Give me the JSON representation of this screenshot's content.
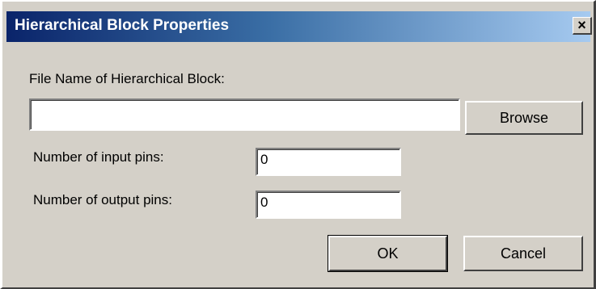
{
  "dialog": {
    "title": "Hierarchical Block Properties",
    "close_label": "×"
  },
  "file_name": {
    "label": "File Name of Hierarchical Block:",
    "value": "",
    "browse_label": "Browse"
  },
  "input_pins": {
    "label": "Number of input pins:",
    "value": "0"
  },
  "output_pins": {
    "label": "Number of output pins:",
    "value": "0"
  },
  "buttons": {
    "ok_label": "OK",
    "cancel_label": "Cancel"
  },
  "colors": {
    "dialog_background": "#d4d0c8",
    "title_gradient_start": "#0a246a",
    "title_gradient_end": "#a6caf0",
    "title_text": "#ffffff"
  }
}
